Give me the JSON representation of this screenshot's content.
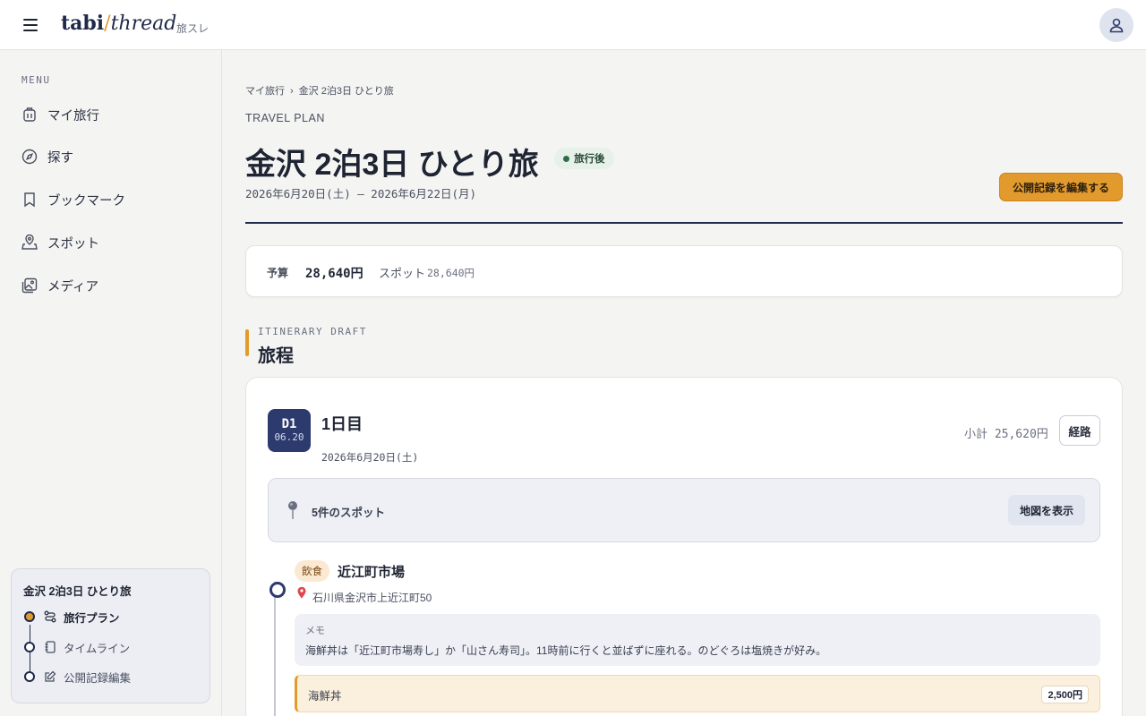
{
  "header": {
    "logo_bold": "tabi",
    "logo_slash": "/",
    "logo_italic": "thread",
    "logo_sub": "旅スレ",
    "icons": {
      "menu": "hamburger-icon",
      "account": "user-icon"
    }
  },
  "sidebar": {
    "menu_heading": "MENU",
    "items": [
      {
        "label": "マイ旅行",
        "icon": "luggage-icon"
      },
      {
        "label": "探す",
        "icon": "compass-icon"
      },
      {
        "label": "ブックマーク",
        "icon": "bookmark-icon"
      },
      {
        "label": "スポット",
        "icon": "map-pin-icon"
      },
      {
        "label": "メディア",
        "icon": "image-icon"
      }
    ],
    "trip_card": {
      "title": "金沢 2泊3日 ひとり旅",
      "steps": [
        {
          "label": "旅行プラン",
          "icon": "route-icon",
          "active": true
        },
        {
          "label": "タイムライン",
          "icon": "notebook-icon",
          "active": false
        },
        {
          "label": "公開記録編集",
          "icon": "edit-icon",
          "active": false
        }
      ]
    }
  },
  "main": {
    "breadcrumb": {
      "parent": "マイ旅行",
      "separator": "›",
      "current": "金沢 2泊3日 ひとり旅"
    },
    "eyebrow": "TRAVEL PLAN",
    "title": "金沢 2泊3日 ひとり旅",
    "status": "旅行後",
    "date_range": "2026年6月20日(土) – 2026年6月22日(月)",
    "edit_public_button": "公開記録を編集する",
    "budget": {
      "label": "予算",
      "total": "28,640円",
      "spot_label": "スポット",
      "spot_value": "28,640円"
    },
    "itinerary": {
      "eyebrow": "ITINERARY DRAFT",
      "title": "旅程"
    },
    "day": {
      "badge_day": "D1",
      "badge_date": "06.20",
      "title": "1日目",
      "date": "2026年6月20日(土)",
      "subtotal": "小計 25,620円",
      "route_button": "経路",
      "spots_count": "5件のスポット",
      "map_button": "地図を表示",
      "spot": {
        "category": "飲食",
        "name": "近江町市場",
        "address": "石川県金沢市上近江町50",
        "memo_label": "メモ",
        "memo": "海鮮丼は「近江町市場寿し」か「山さん寿司」。11時前に行くと並ばずに座れる。のどぐろは塩焼きが好み。",
        "item_name": "海鮮丼",
        "item_price": "2,500円"
      }
    }
  },
  "colors": {
    "accent": "#e39a2c",
    "navy": "#1f2a4a",
    "day_badge": "#2d3a6e",
    "status_bg": "#e7f1ea"
  }
}
